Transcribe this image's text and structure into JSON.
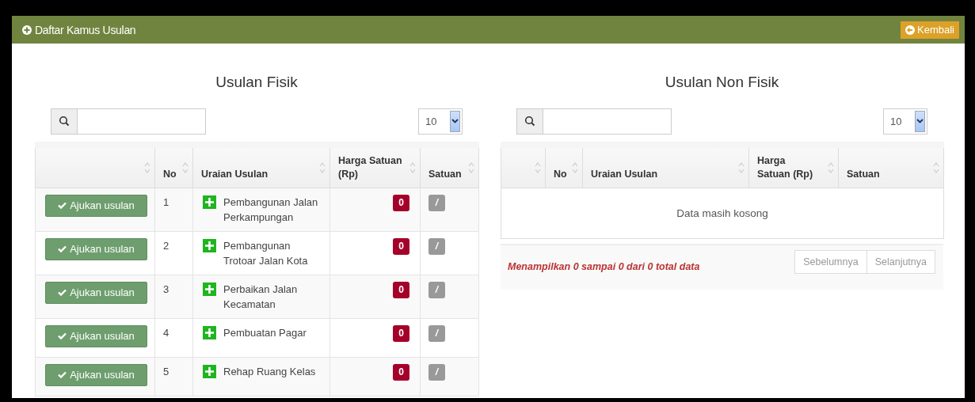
{
  "header": {
    "title": "Daftar Kamus Usulan",
    "back_button": "Kembali"
  },
  "panels": [
    {
      "title": "Usulan Fisik",
      "page_size": "10",
      "columns": [
        "No",
        "Uraian Usulan",
        "Harga Satuan (Rp)",
        "Satuan"
      ],
      "rows": [
        {
          "action": "Ajukan usulan",
          "no": "1",
          "name": "Pembangunan Jalan Perkampungan",
          "price": "0",
          "unit": "/"
        },
        {
          "action": "Ajukan usulan",
          "no": "2",
          "name": "Pembangunan Trotoar Jalan Kota",
          "price": "0",
          "unit": "/"
        },
        {
          "action": "Ajukan usulan",
          "no": "3",
          "name": "Perbaikan Jalan Kecamatan",
          "price": "0",
          "unit": "/"
        },
        {
          "action": "Ajukan usulan",
          "no": "4",
          "name": "Pembuatan Pagar",
          "price": "0",
          "unit": "/"
        },
        {
          "action": "Ajukan usulan",
          "no": "5",
          "name": "Rehap Ruang Kelas",
          "price": "0",
          "unit": "/"
        }
      ]
    },
    {
      "title": "Usulan Non Fisik",
      "page_size": "10",
      "columns": [
        "No",
        "Uraian Usulan",
        "Harga Satuan (Rp)",
        "Satuan"
      ],
      "empty_message": "Data masih kosong",
      "info": "Menampilkan 0 sampai 0 dari 0 total data",
      "pagination": [
        {
          "label": "Sebelumnya",
          "disabled": true
        },
        {
          "label": "Selanjutnya",
          "disabled": true
        }
      ]
    }
  ]
}
